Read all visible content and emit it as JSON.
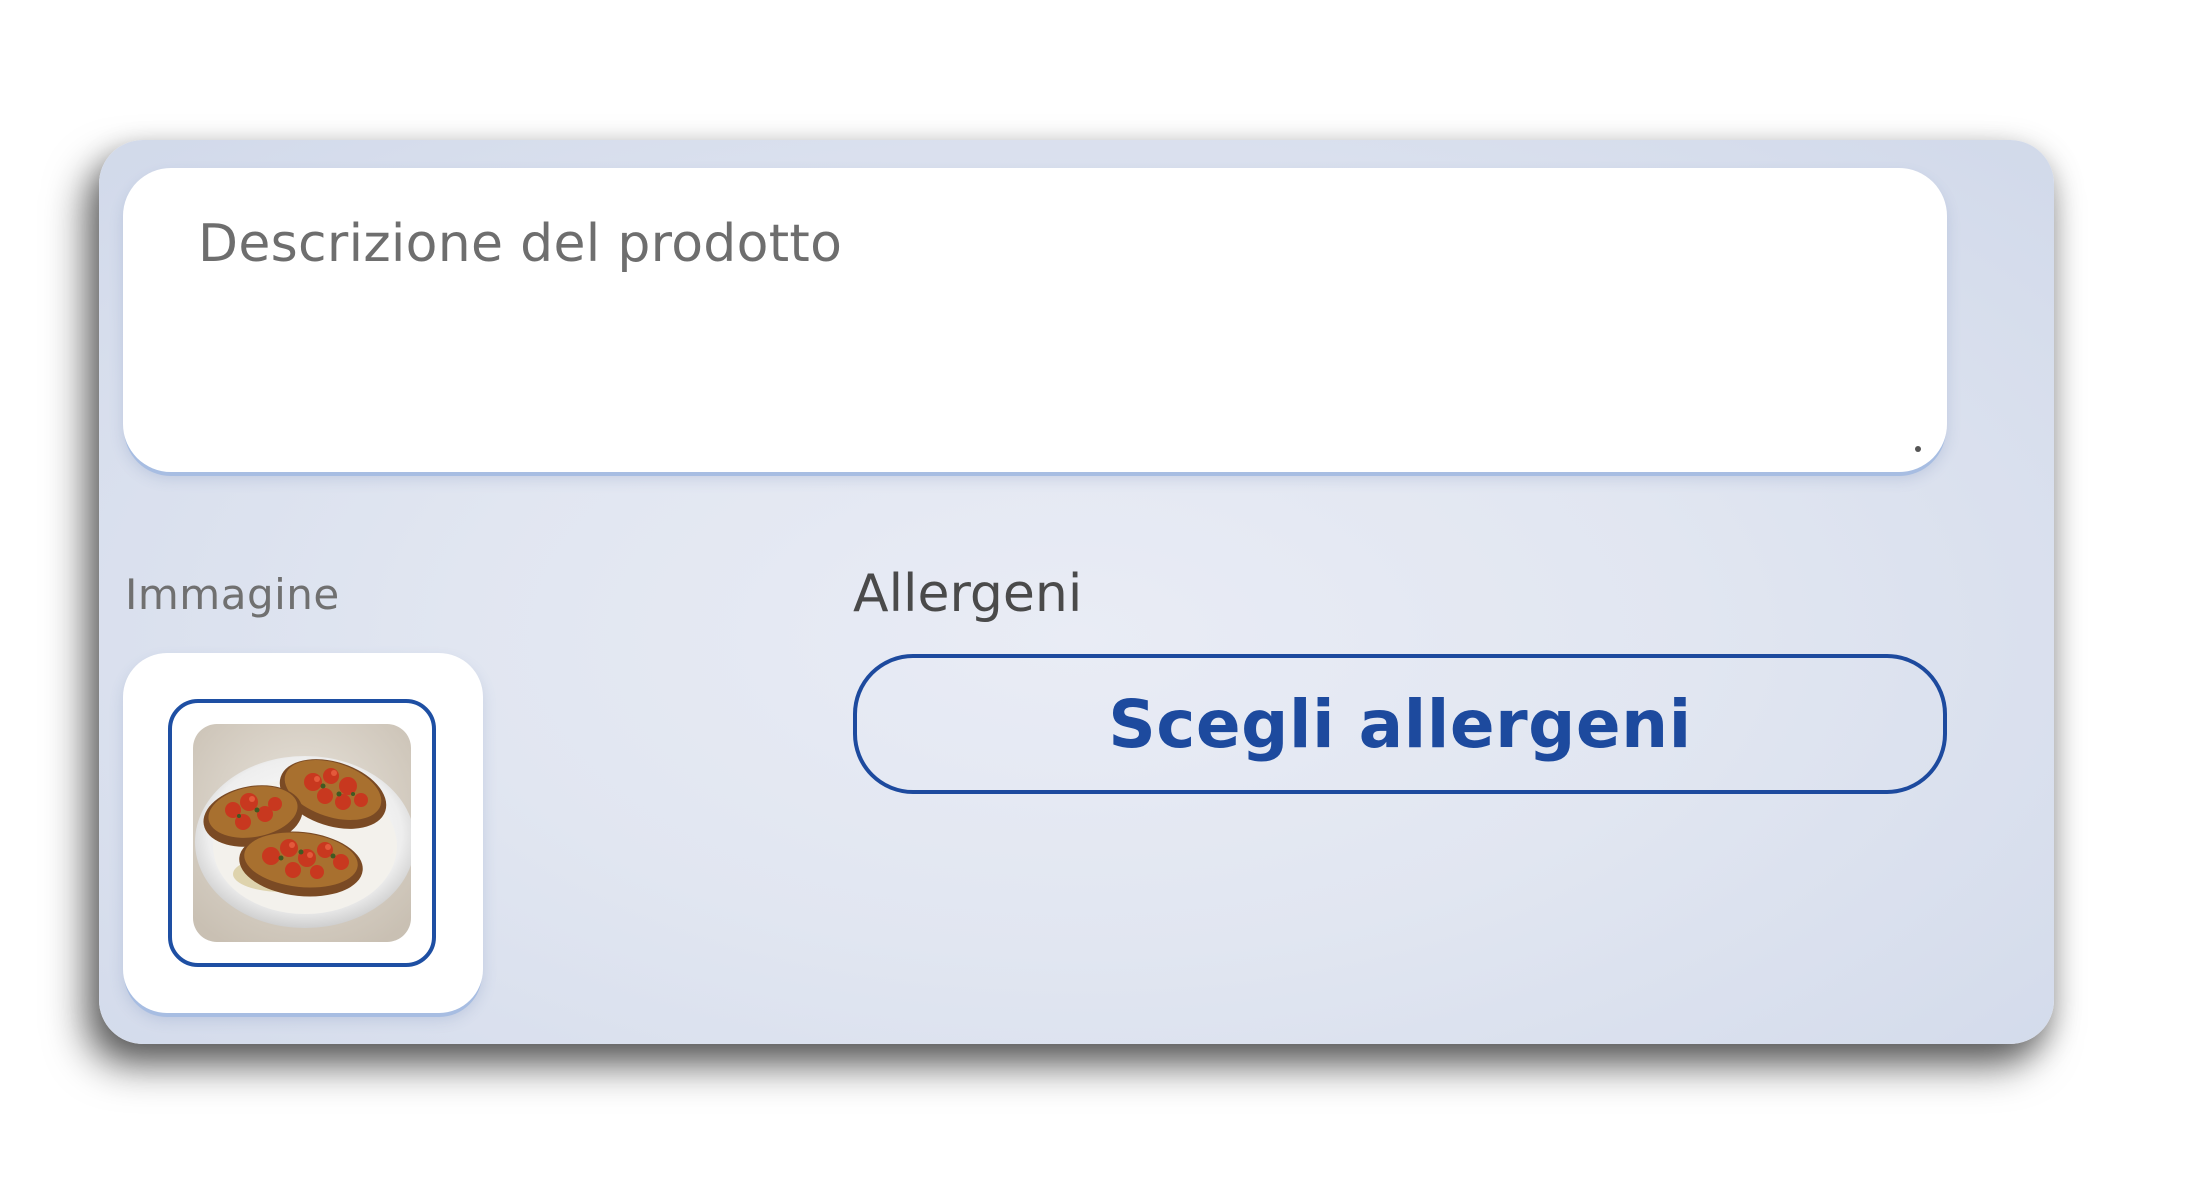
{
  "product_form": {
    "description": {
      "placeholder": "Descrizione del prodotto",
      "value": ""
    },
    "image": {
      "label": "Immagine",
      "thumbnail_subject": "bruschetta-on-plate"
    },
    "allergens": {
      "label": "Allergeni",
      "button_label": "Scegli allergeni"
    }
  },
  "colors": {
    "accent": "#1d4a9e",
    "panel_bg": "#e1e6f1",
    "field_bg": "#ffffff",
    "placeholder_text": "#6e6e6e"
  }
}
